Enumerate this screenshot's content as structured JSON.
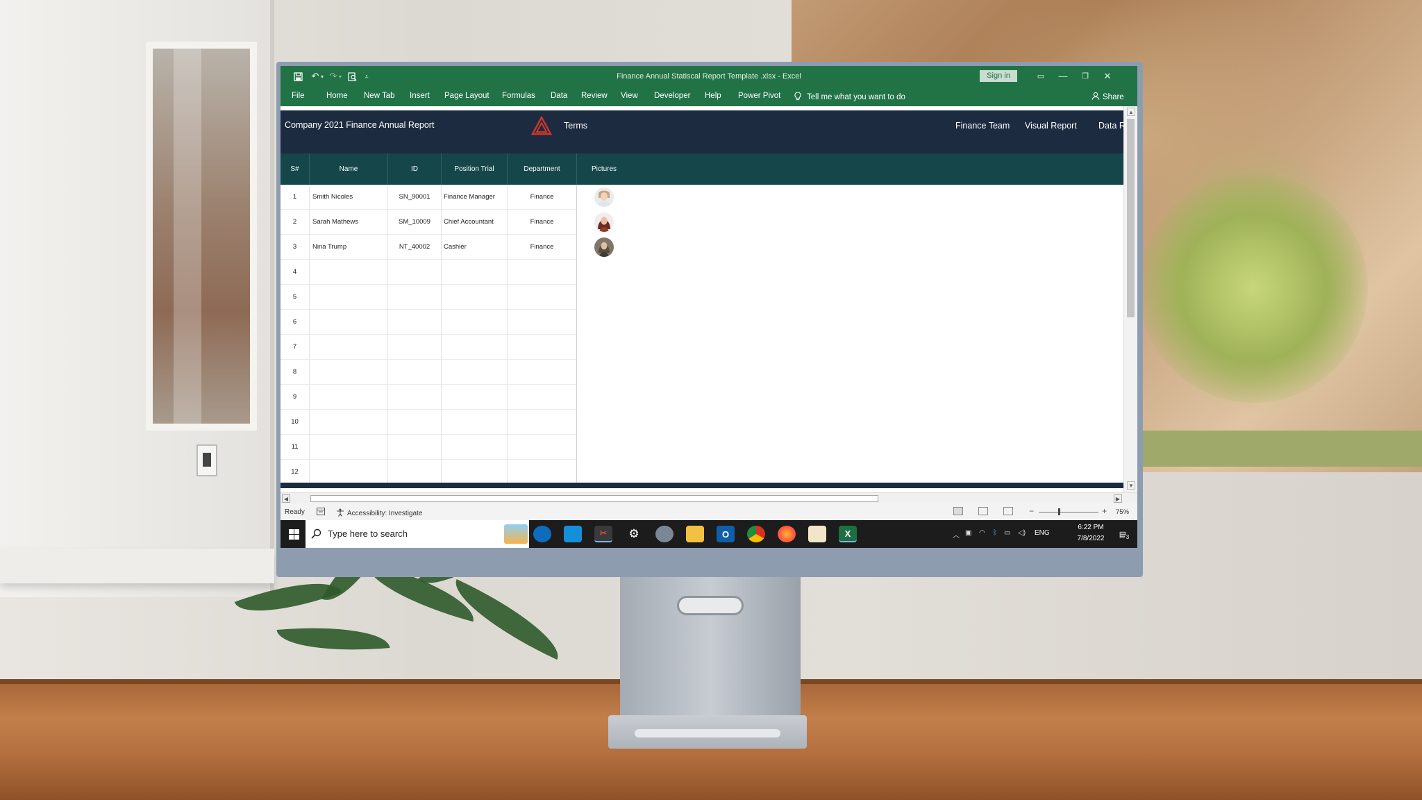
{
  "window": {
    "title": "Finance Annual Statiscal Report Template .xlsx  -  Excel",
    "sign_in": "Sign in",
    "min": "—",
    "restore": "❐",
    "close": "✕"
  },
  "ribbon": {
    "tabs": [
      "File",
      "Home",
      "New Tab",
      "Insert",
      "Page Layout",
      "Formulas",
      "Data",
      "Review",
      "View",
      "Developer",
      "Help",
      "Power Pivot"
    ],
    "tell_me": "Tell me what you want to do",
    "share": "Share"
  },
  "banner": {
    "company": "Company 2021 Finance Annual Report",
    "terms": "Terms",
    "nav_finance_team": "Finance Team",
    "nav_visual_report": "Visual Report",
    "nav_data": "Data R"
  },
  "table": {
    "headers": {
      "sn": "S#",
      "name": "Name",
      "id": "ID",
      "position": "Position Trial",
      "department": "Department",
      "pictures": "Pictures"
    },
    "rows": [
      {
        "sn": "1",
        "name": "Smith Nicoles",
        "id": "SN_90001",
        "position": "Finance Manager",
        "department": "Finance"
      },
      {
        "sn": "2",
        "name": "Sarah Mathews",
        "id": "SM_10009",
        "position": "Chief Accountant",
        "department": "Finance"
      },
      {
        "sn": "3",
        "name": "Nina Trump",
        "id": "NT_40002",
        "position": "Cashier",
        "department": "Finance"
      },
      {
        "sn": "4",
        "name": "",
        "id": "",
        "position": "",
        "department": ""
      },
      {
        "sn": "5",
        "name": "",
        "id": "",
        "position": "",
        "department": ""
      },
      {
        "sn": "6",
        "name": "",
        "id": "",
        "position": "",
        "department": ""
      },
      {
        "sn": "7",
        "name": "",
        "id": "",
        "position": "",
        "department": ""
      },
      {
        "sn": "8",
        "name": "",
        "id": "",
        "position": "",
        "department": ""
      },
      {
        "sn": "9",
        "name": "",
        "id": "",
        "position": "",
        "department": ""
      },
      {
        "sn": "10",
        "name": "",
        "id": "",
        "position": "",
        "department": ""
      },
      {
        "sn": "11",
        "name": "",
        "id": "",
        "position": "",
        "department": ""
      },
      {
        "sn": "12",
        "name": "",
        "id": "",
        "position": "",
        "department": ""
      }
    ]
  },
  "status": {
    "ready": "Ready",
    "accessibility": "Accessibility: Investigate",
    "zoom_minus": "−",
    "zoom_plus": "+",
    "zoom": "75%"
  },
  "taskbar": {
    "search_placeholder": "Type here to search",
    "lang": "ENG",
    "time": "6:22 PM",
    "date": "7/8/2022",
    "notifications": "3"
  },
  "colors": {
    "excel_green": "#217346",
    "banner_navy": "#1c2b3f",
    "header_teal": "#14464a",
    "logo_red": "#c0392b"
  }
}
